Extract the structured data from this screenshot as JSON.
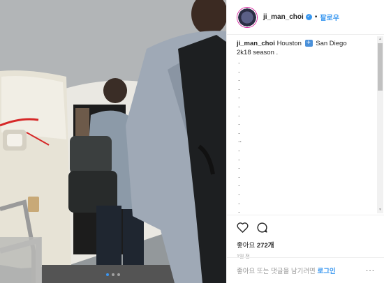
{
  "post": {
    "username": "ji_man_choi",
    "verified_badge": "✓",
    "separator": "•",
    "follow_label": "팔로우",
    "caption_user": "ji_man_choi",
    "caption_text_before": "Houston",
    "caption_text_after": "San Diego",
    "caption_line2": "2k18 season .",
    "emoji": "airplane-emoji",
    "dot_lines": [
      ".",
      ".",
      ".",
      ".",
      ".",
      ".",
      ".",
      ".",
      ".",
      "..",
      ".",
      ".",
      ".",
      ".",
      ".",
      ".",
      ".",
      "."
    ],
    "likes_label": "좋아요",
    "likes_count": "272개",
    "timestamp": "1일 전",
    "comment_placeholder": "좋아요 또는 댓글을 남기려면",
    "login_label": "로그인",
    "more_label": "···"
  },
  "carousel": {
    "slides": 3,
    "active": 1
  },
  "colors": {
    "link": "#3897f0",
    "text": "#262626",
    "muted": "#999999",
    "border": "#efefef"
  },
  "icons": [
    "heart-icon",
    "comment-icon",
    "more-options-icon",
    "verified-icon",
    "airplane-emoji"
  ]
}
